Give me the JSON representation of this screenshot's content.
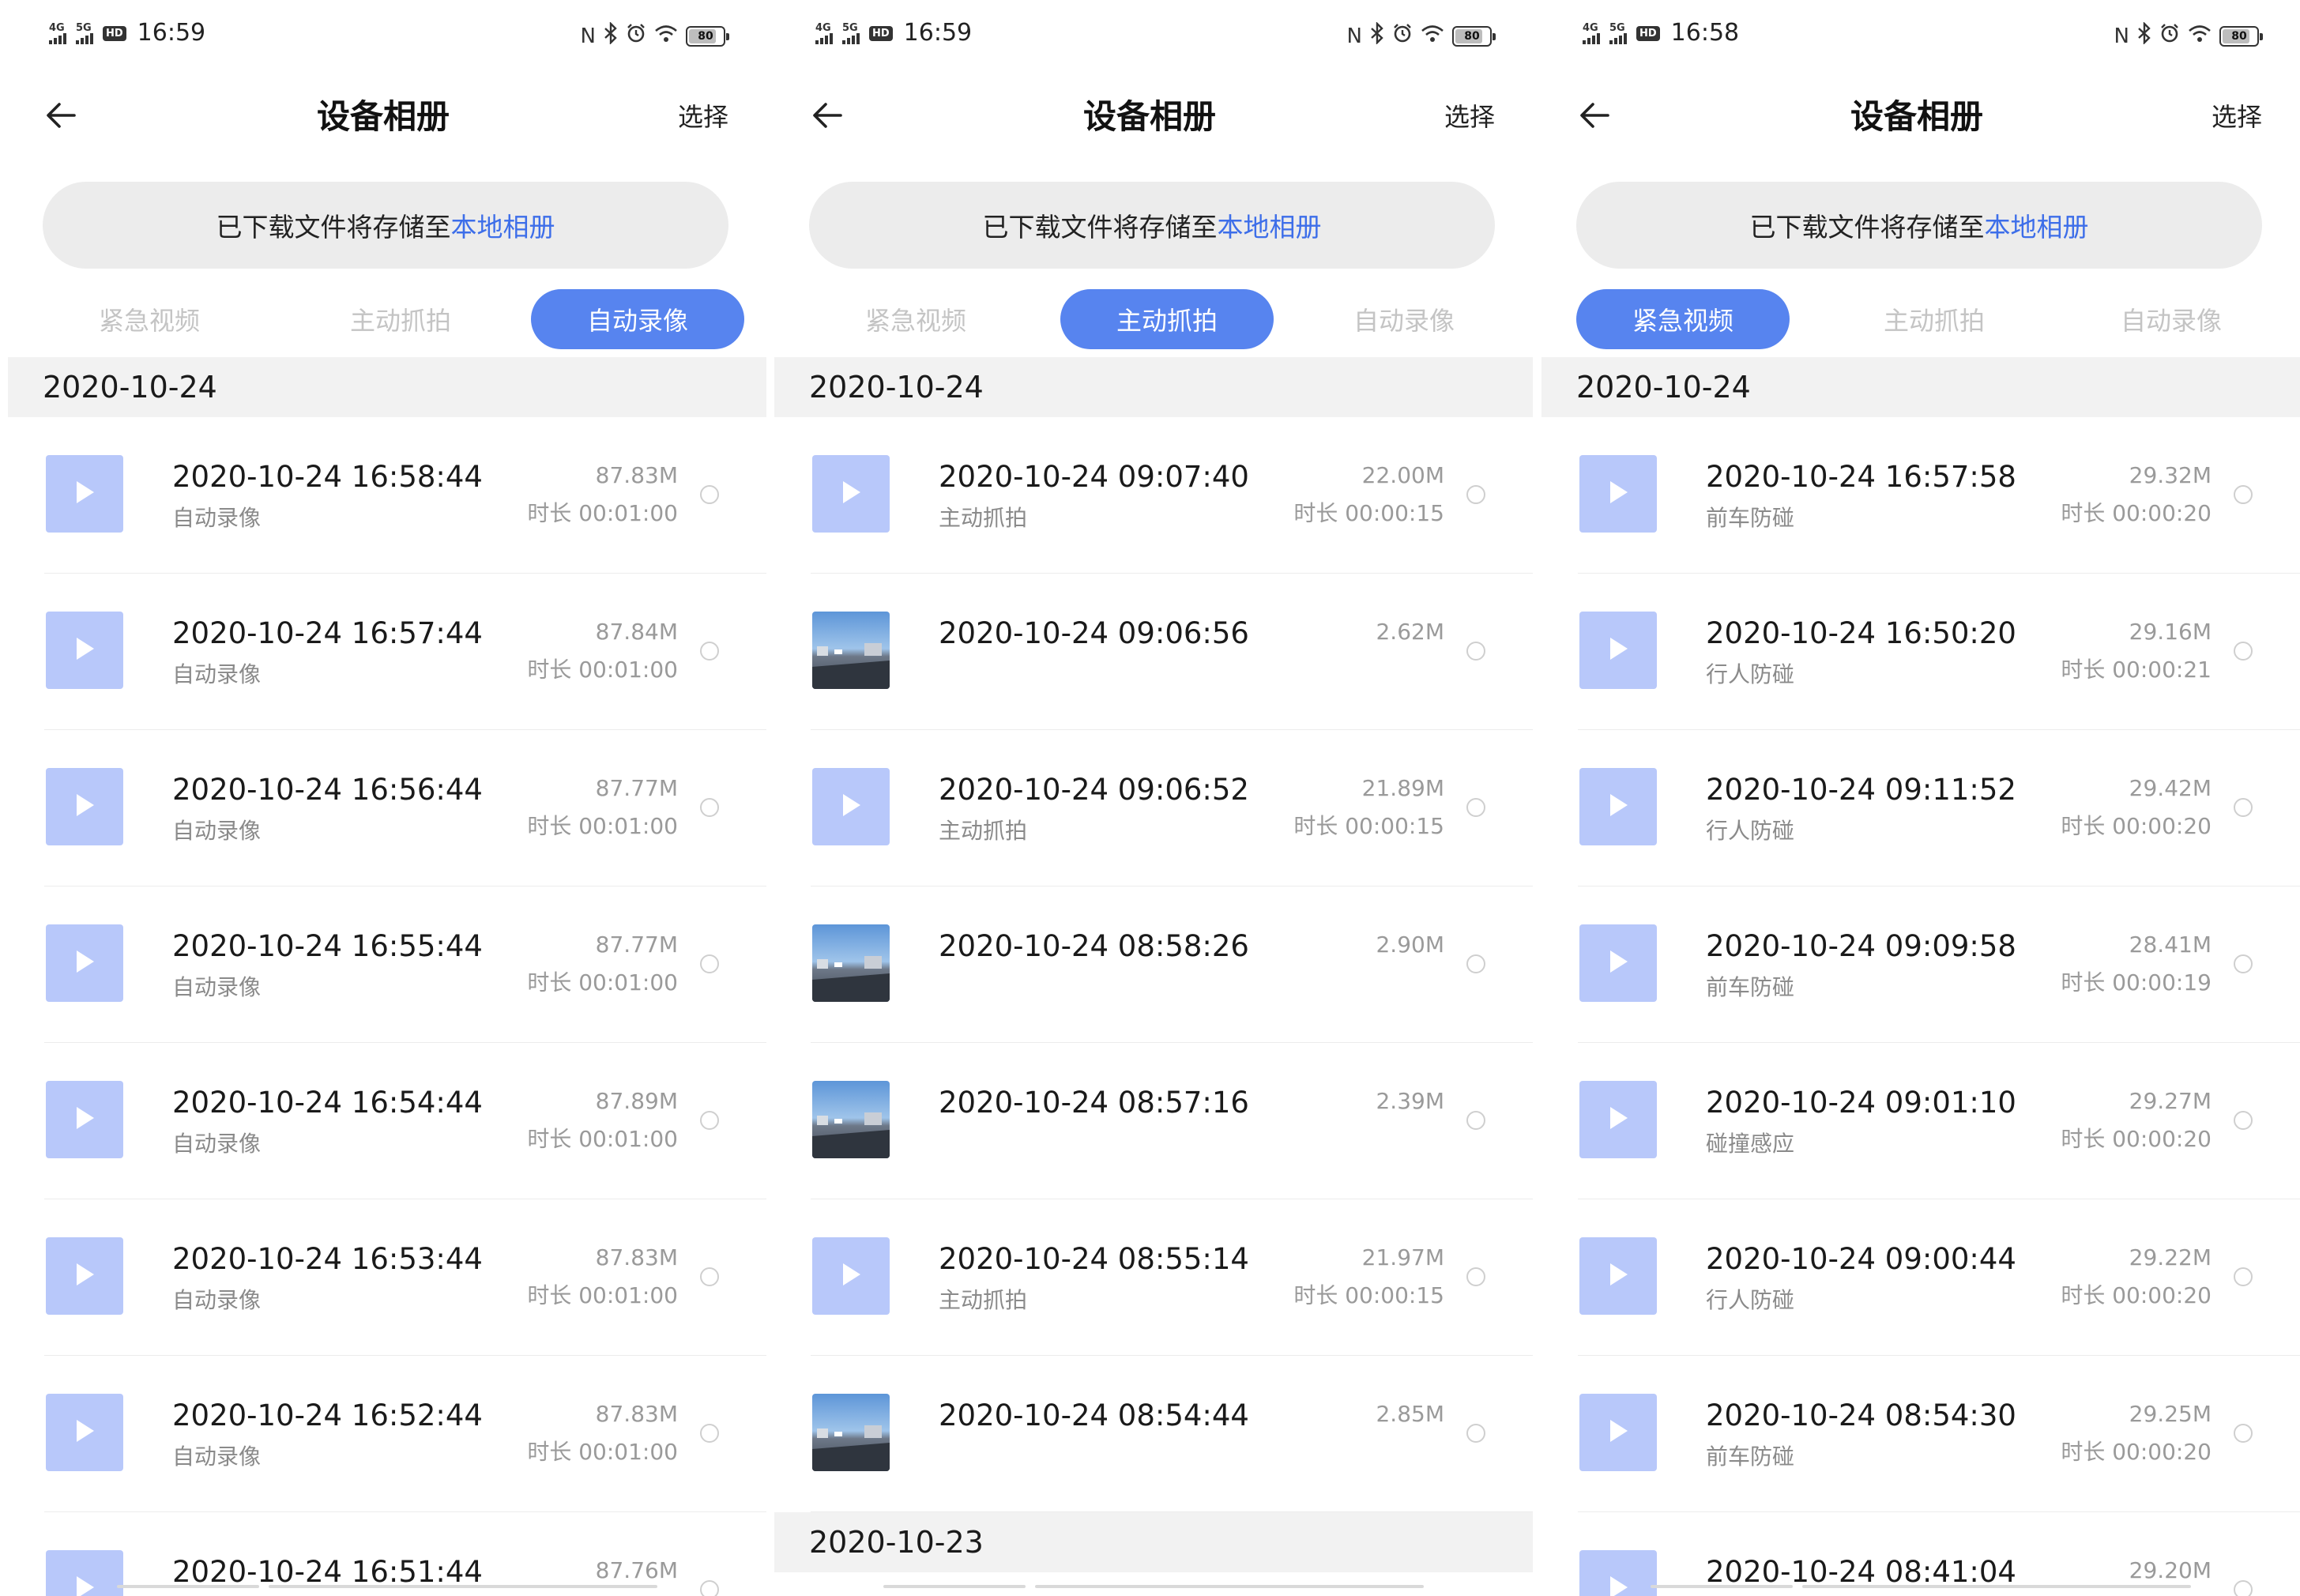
{
  "status_bars": [
    {
      "net1": "4G",
      "net2": "5G",
      "hd": "HD",
      "time": "16:59",
      "battery": "80"
    },
    {
      "net1": "4G",
      "net2": "5G",
      "hd": "HD",
      "time": "16:59",
      "battery": "80"
    },
    {
      "net1": "4G",
      "net2": "5G",
      "hd": "HD",
      "time": "16:58",
      "battery": "80"
    }
  ],
  "battery_percent": 80,
  "colors": {
    "accent": "#5784ef",
    "link": "#3d6ee9",
    "video_thumb": "#b8c8fa",
    "notice_bg": "#ececec",
    "date_header_bg": "#f2f2f2",
    "inactive_tab": "#c4c4c4"
  },
  "icons": [
    "back-arrow-icon",
    "nfc-icon",
    "bluetooth-icon",
    "alarm-icon",
    "wifi-icon",
    "battery-icon",
    "play-icon",
    "radio-unchecked-icon"
  ],
  "header": {
    "title": "设备相册",
    "select_label": "选择"
  },
  "notice": {
    "text": "已下载文件将存储至",
    "link": "本地相册"
  },
  "tabs": [
    "紧急视频",
    "主动抓拍",
    "自动录像"
  ],
  "screens": [
    {
      "active_tab": 2,
      "groups": [
        {
          "date": "2020-10-24",
          "items": [
            {
              "time": "2020-10-24 16:58:44",
              "type": "自动录像",
              "size": "87.83M",
              "duration": "时长 00:01:00",
              "media": "video"
            },
            {
              "time": "2020-10-24 16:57:44",
              "type": "自动录像",
              "size": "87.84M",
              "duration": "时长 00:01:00",
              "media": "video"
            },
            {
              "time": "2020-10-24 16:56:44",
              "type": "自动录像",
              "size": "87.77M",
              "duration": "时长 00:01:00",
              "media": "video"
            },
            {
              "time": "2020-10-24 16:55:44",
              "type": "自动录像",
              "size": "87.77M",
              "duration": "时长 00:01:00",
              "media": "video"
            },
            {
              "time": "2020-10-24 16:54:44",
              "type": "自动录像",
              "size": "87.89M",
              "duration": "时长 00:01:00",
              "media": "video"
            },
            {
              "time": "2020-10-24 16:53:44",
              "type": "自动录像",
              "size": "87.83M",
              "duration": "时长 00:01:00",
              "media": "video"
            },
            {
              "time": "2020-10-24 16:52:44",
              "type": "自动录像",
              "size": "87.83M",
              "duration": "时长 00:01:00",
              "media": "video"
            },
            {
              "time": "2020-10-24 16:51:44",
              "type": "",
              "size": "87.76M",
              "duration": "",
              "media": "video"
            }
          ]
        }
      ]
    },
    {
      "active_tab": 1,
      "groups": [
        {
          "date": "2020-10-24",
          "items": [
            {
              "time": "2020-10-24 09:07:40",
              "type": "主动抓拍",
              "size": "22.00M",
              "duration": "时长 00:00:15",
              "media": "video"
            },
            {
              "time": "2020-10-24 09:06:56",
              "type": "",
              "size": "2.62M",
              "duration": "",
              "media": "photo"
            },
            {
              "time": "2020-10-24 09:06:52",
              "type": "主动抓拍",
              "size": "21.89M",
              "duration": "时长 00:00:15",
              "media": "video"
            },
            {
              "time": "2020-10-24 08:58:26",
              "type": "",
              "size": "2.90M",
              "duration": "",
              "media": "photo"
            },
            {
              "time": "2020-10-24 08:57:16",
              "type": "",
              "size": "2.39M",
              "duration": "",
              "media": "photo"
            },
            {
              "time": "2020-10-24 08:55:14",
              "type": "主动抓拍",
              "size": "21.97M",
              "duration": "时长 00:00:15",
              "media": "video"
            },
            {
              "time": "2020-10-24 08:54:44",
              "type": "",
              "size": "2.85M",
              "duration": "",
              "media": "photo"
            }
          ]
        },
        {
          "date": "2020-10-23",
          "items": []
        }
      ]
    },
    {
      "active_tab": 0,
      "groups": [
        {
          "date": "2020-10-24",
          "items": [
            {
              "time": "2020-10-24 16:57:58",
              "type": "前车防碰",
              "size": "29.32M",
              "duration": "时长 00:00:20",
              "media": "video"
            },
            {
              "time": "2020-10-24 16:50:20",
              "type": "行人防碰",
              "size": "29.16M",
              "duration": "时长 00:00:21",
              "media": "video"
            },
            {
              "time": "2020-10-24 09:11:52",
              "type": "行人防碰",
              "size": "29.42M",
              "duration": "时长 00:00:20",
              "media": "video"
            },
            {
              "time": "2020-10-24 09:09:58",
              "type": "前车防碰",
              "size": "28.41M",
              "duration": "时长 00:00:19",
              "media": "video"
            },
            {
              "time": "2020-10-24 09:01:10",
              "type": "碰撞感应",
              "size": "29.27M",
              "duration": "时长 00:00:20",
              "media": "video"
            },
            {
              "time": "2020-10-24 09:00:44",
              "type": "行人防碰",
              "size": "29.22M",
              "duration": "时长 00:00:20",
              "media": "video"
            },
            {
              "time": "2020-10-24 08:54:30",
              "type": "前车防碰",
              "size": "29.25M",
              "duration": "时长 00:00:20",
              "media": "video"
            },
            {
              "time": "2020-10-24 08:41:04",
              "type": "",
              "size": "29.20M",
              "duration": "",
              "media": "video"
            }
          ]
        }
      ]
    }
  ]
}
